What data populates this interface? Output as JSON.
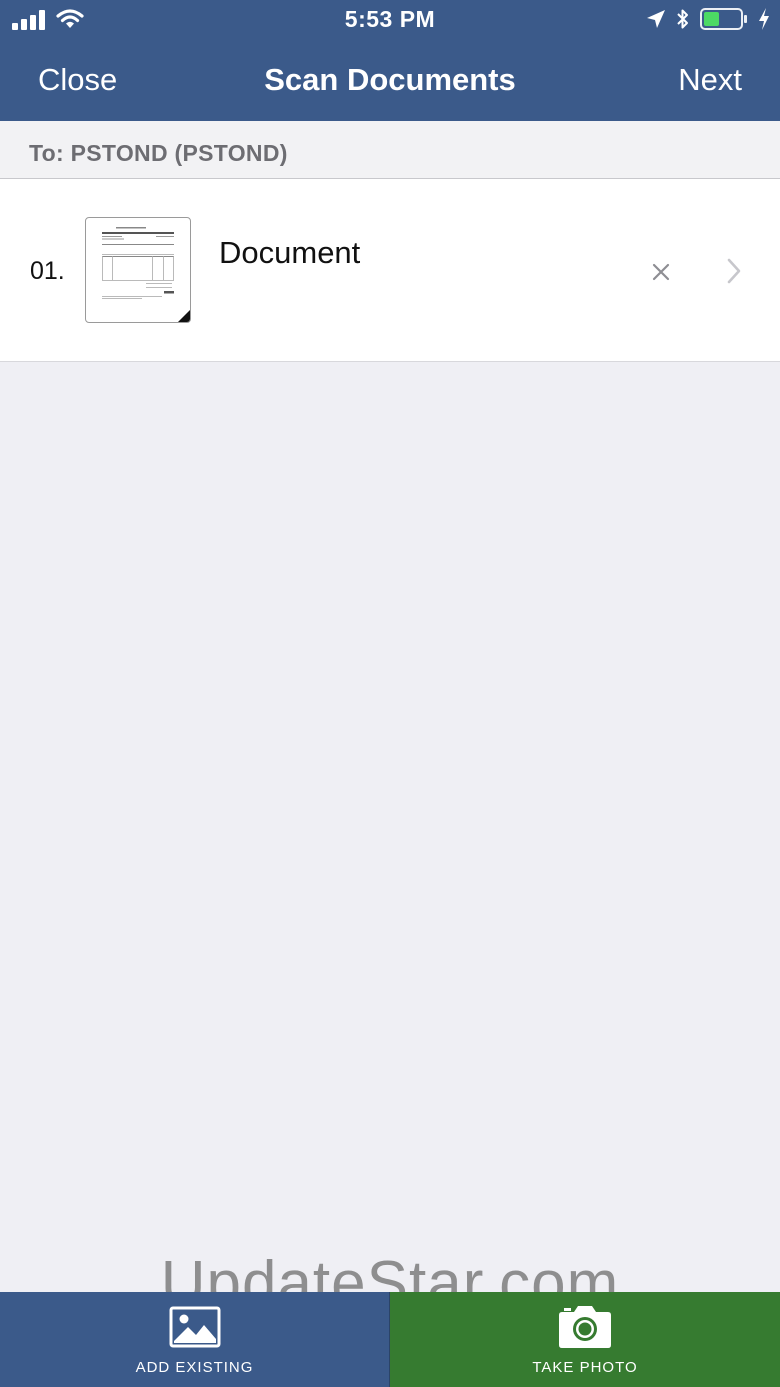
{
  "status_bar": {
    "time": "5:53 PM",
    "icons": [
      "cellular-signal-icon",
      "wifi-icon",
      "location-arrow-icon",
      "bluetooth-icon",
      "battery-icon",
      "charging-bolt-icon"
    ],
    "battery_color": "#4cd964"
  },
  "nav": {
    "close_label": "Close",
    "title": "Scan Documents",
    "next_label": "Next"
  },
  "recipient": {
    "label": "To: PSTOND (PSTOND)"
  },
  "documents": [
    {
      "index": "01.",
      "name": "Document"
    }
  ],
  "toolbar": {
    "add_existing_label": "ADD EXISTING",
    "take_photo_label": "TAKE PHOTO"
  },
  "watermark": "UpdateStar.com",
  "colors": {
    "header": "#3b5a8a",
    "take_photo": "#367b30",
    "background": "#efeff4"
  }
}
